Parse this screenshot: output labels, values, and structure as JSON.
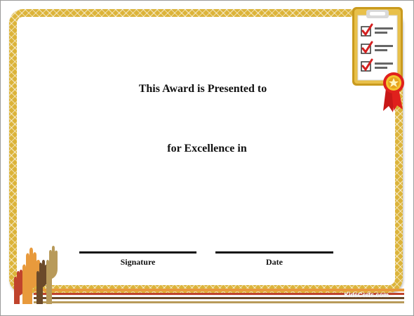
{
  "certificate": {
    "presented_line": "This Award is Presented to",
    "excellence_line": "for Excellence in",
    "signature_label": "Signature",
    "date_label": "Date",
    "watermark": "KidsCerts.com"
  },
  "colors": {
    "border_gold": "#dcb43a",
    "ribbon_red": "#e0201c",
    "check_red": "#d42020",
    "stripe_orange": "#e89a3c",
    "stripe_red": "#c0432c",
    "stripe_brown": "#6b4a2a"
  },
  "icons": {
    "clipboard": "clipboard-checklist-icon",
    "ribbon": "award-ribbon-icon",
    "hands": "raised-hands-icon"
  }
}
